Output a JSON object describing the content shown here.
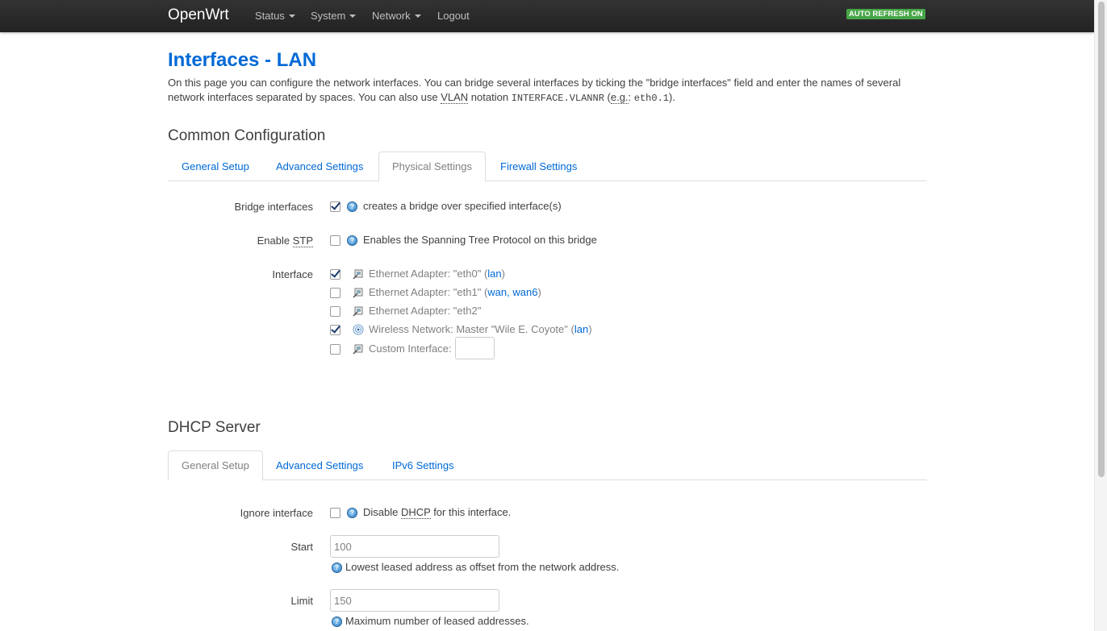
{
  "navbar": {
    "brand": "OpenWrt",
    "menu": [
      "Status",
      "System",
      "Network",
      "Logout"
    ],
    "auto_refresh": "AUTO REFRESH ON"
  },
  "page": {
    "title": "Interfaces - LAN",
    "desc_1": "On this page you can configure the network interfaces. You can bridge several interfaces by ticking the \"bridge interfaces\" field and enter the names of several network interfaces separated by spaces. You can also use ",
    "desc_vlan": "VLAN",
    "desc_2": " notation ",
    "desc_code1": "INTERFACE.VLANNR",
    "desc_3": " (",
    "desc_eg": "e.g.",
    "desc_4": ": ",
    "desc_code2": "eth0.1",
    "desc_5": ")."
  },
  "common": {
    "heading": "Common Configuration",
    "tabs": [
      "General Setup",
      "Advanced Settings",
      "Physical Settings",
      "Firewall Settings"
    ],
    "active_tab": "Physical Settings",
    "bridge": {
      "label": "Bridge interfaces",
      "checked": true,
      "help": "creates a bridge over specified interface(s)"
    },
    "stp": {
      "label_pre": "Enable ",
      "label_abbr": "STP",
      "checked": false,
      "help": "Enables the Spanning Tree Protocol on this bridge"
    },
    "interface": {
      "label": "Interface",
      "options": [
        {
          "text": "Ethernet Adapter: \"eth0\"",
          "nets": "lan",
          "checked": true,
          "icon": "ethernet-icon"
        },
        {
          "text": "Ethernet Adapter: \"eth1\"",
          "nets": "wan, wan6",
          "checked": false,
          "icon": "ethernet-icon"
        },
        {
          "text": "Ethernet Adapter: \"eth2\"",
          "nets": "",
          "checked": false,
          "icon": "ethernet-icon"
        },
        {
          "text": "Wireless Network: Master \"Wile E. Coyote\"",
          "nets": "lan",
          "checked": true,
          "icon": "wireless-icon"
        },
        {
          "text": "Custom Interface:",
          "nets": "",
          "checked": false,
          "icon": "ethernet-icon",
          "custom_value": ""
        }
      ]
    }
  },
  "dhcp": {
    "heading": "DHCP Server",
    "tabs": [
      "General Setup",
      "Advanced Settings",
      "IPv6 Settings"
    ],
    "active_tab": "General Setup",
    "ignore": {
      "label": "Ignore interface",
      "checked": false,
      "help_pre": "Disable ",
      "help_abbr": "DHCP",
      "help_post": " for this interface."
    },
    "start": {
      "label": "Start",
      "value": "100",
      "help": "Lowest leased address as offset from the network address."
    },
    "limit": {
      "label": "Limit",
      "value": "150",
      "help": "Maximum number of leased addresses."
    }
  }
}
